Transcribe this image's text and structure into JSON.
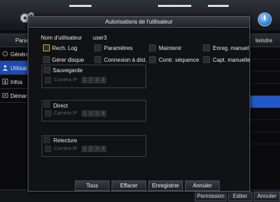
{
  "background": {
    "header_left": "Paramèt",
    "header_right": "teindre",
    "menu": [
      {
        "label": "Généra",
        "icon": "gear-icon"
      },
      {
        "label": "Utilisat",
        "icon": "user-icon"
      },
      {
        "label": "Infos",
        "icon": "info-icon"
      },
      {
        "label": "Démar",
        "icon": "startup-icon"
      }
    ],
    "bottom_buttons": [
      "Permission",
      "Editer",
      "Annuler"
    ]
  },
  "dialog": {
    "title": "Autorisations de l'utilisateur",
    "username_label": "Nom d'utilisateur",
    "username_value": "user3",
    "permissions_row1": [
      "Rech. Log",
      "Paramètres",
      "Maintenir",
      "Enreg. manuel"
    ],
    "permissions_row2": [
      "Gérer disque",
      "Connexion à dist.",
      "Contr. séquence",
      "Capt. manuelle"
    ],
    "groups": [
      {
        "label": "Sauvegarde",
        "camera_label": "Caméra IP",
        "channels": [
          "1",
          "2",
          "3",
          "4"
        ]
      },
      {
        "label": "Direct",
        "camera_label": "Caméra IP",
        "channels": [
          "1",
          "2",
          "3",
          "4"
        ]
      },
      {
        "label": "Relecture",
        "camera_label": "Caméra IP",
        "channels": [
          "1",
          "2",
          "3",
          "4"
        ]
      }
    ],
    "buttons": [
      "Tous",
      "Effacer",
      "Enregistrer",
      "Annuler"
    ]
  },
  "colors": {
    "focus": "#d3b21e",
    "selected_menu": "#1e4bb0"
  }
}
